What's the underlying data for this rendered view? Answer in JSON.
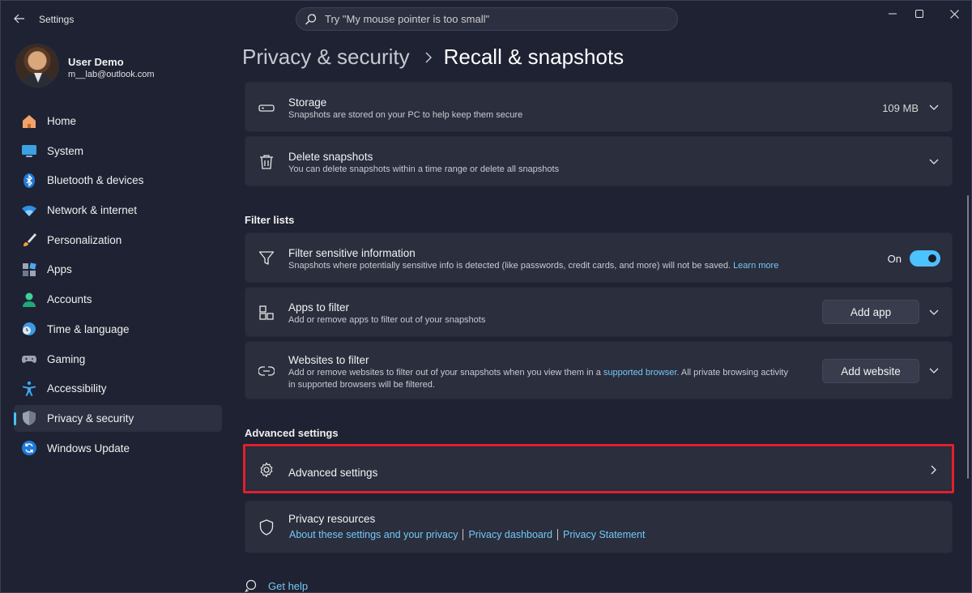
{
  "window": {
    "app_title": "Settings",
    "search_placeholder": "Try \"My mouse pointer is too small\""
  },
  "profile": {
    "name": "User Demo",
    "email": "m__lab@outlook.com"
  },
  "sidebar": {
    "items": [
      {
        "label": "Home",
        "icon": "home-icon"
      },
      {
        "label": "System",
        "icon": "monitor-icon"
      },
      {
        "label": "Bluetooth & devices",
        "icon": "bluetooth-icon"
      },
      {
        "label": "Network & internet",
        "icon": "wifi-icon"
      },
      {
        "label": "Personalization",
        "icon": "brush-icon"
      },
      {
        "label": "Apps",
        "icon": "apps-icon"
      },
      {
        "label": "Accounts",
        "icon": "person-icon"
      },
      {
        "label": "Time & language",
        "icon": "clock-globe-icon"
      },
      {
        "label": "Gaming",
        "icon": "gamepad-icon"
      },
      {
        "label": "Accessibility",
        "icon": "accessibility-icon"
      },
      {
        "label": "Privacy & security",
        "icon": "shield-icon",
        "active": true
      },
      {
        "label": "Windows Update",
        "icon": "update-icon"
      }
    ]
  },
  "breadcrumb": {
    "parent": "Privacy & security",
    "current": "Recall & snapshots"
  },
  "storage": {
    "title": "Storage",
    "description": "Snapshots are stored on your PC to help keep them secure",
    "value": "109 MB"
  },
  "delete_snapshots": {
    "title": "Delete snapshots",
    "description": "You can delete snapshots within a time range or delete all snapshots"
  },
  "filter_lists": {
    "section_title": "Filter lists",
    "sensitive": {
      "title": "Filter sensitive information",
      "description": "Snapshots where potentially sensitive info is detected (like passwords, credit cards, and more) will not be saved.",
      "link": "Learn more",
      "toggle_label": "On",
      "toggle_on": true
    },
    "apps": {
      "title": "Apps to filter",
      "description": "Add or remove apps to filter out of your snapshots",
      "button": "Add app"
    },
    "websites": {
      "title": "Websites to filter",
      "description_1": "Add or remove websites to filter out of your snapshots when you view them in a",
      "link": "supported browser.",
      "description_2": "All private browsing activity",
      "description_3": "in supported browsers will be filtered.",
      "button": "Add website"
    }
  },
  "advanced": {
    "section_title": "Advanced settings",
    "item_title": "Advanced settings"
  },
  "privacy_resources": {
    "title": "Privacy resources",
    "links": [
      "About these settings and your privacy",
      "Privacy dashboard",
      "Privacy Statement"
    ]
  },
  "get_help": "Get help",
  "colors": {
    "accent": "#4cc2ff",
    "highlight_border": "#e0202f",
    "background": "#1e2233",
    "card": "#2a2e3d"
  }
}
